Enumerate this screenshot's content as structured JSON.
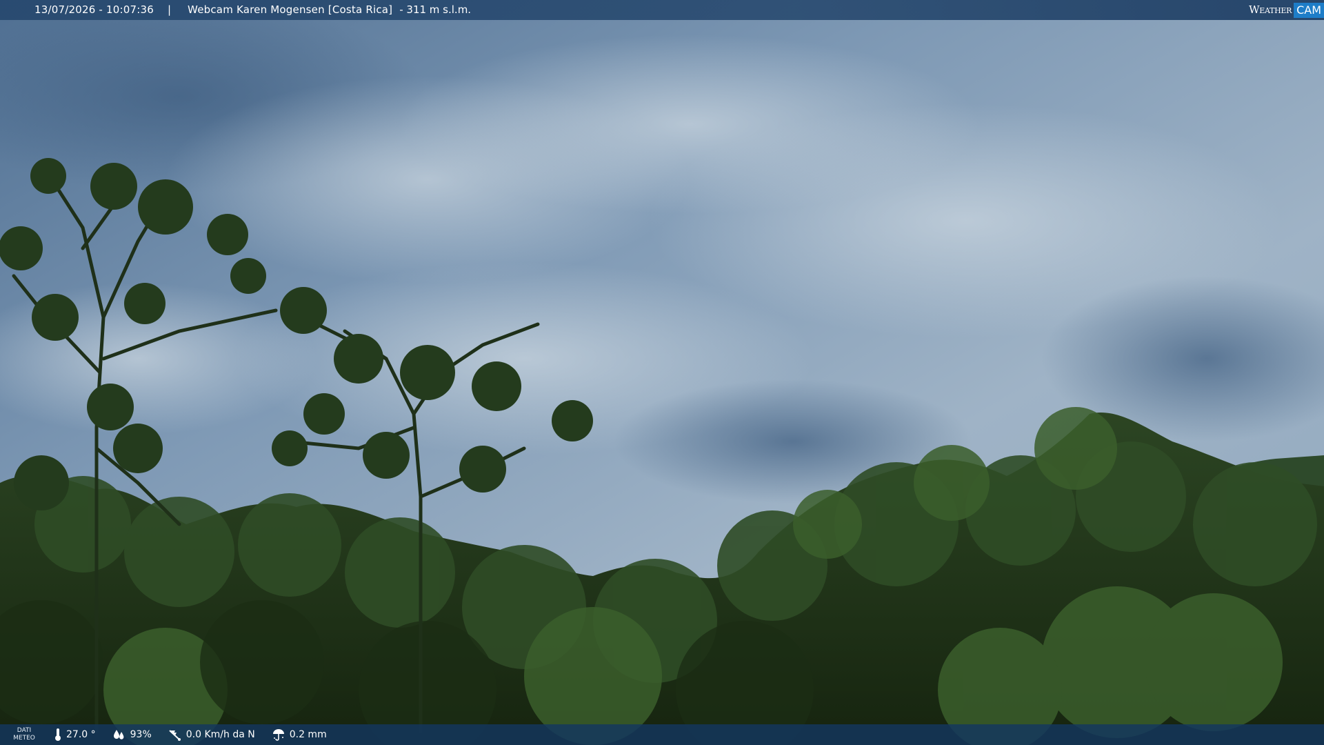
{
  "overlay_top": {
    "datetime": "13/07/2026 - 10:07:36",
    "separator": "|",
    "camera_name": "Webcam Karen Mogensen [Costa Rica]",
    "altitude": "- 311 m s.l.m."
  },
  "logo": {
    "word": "Weather",
    "cam": "CAM"
  },
  "overlay_bottom": {
    "label_line1": "DATI",
    "label_line2": "METEO",
    "temperature": "27.0 °",
    "humidity": "93%",
    "wind": "0.0 Km/h da N",
    "rain": "0.2 mm"
  },
  "icons": [
    "thermometer-icon",
    "humidity-drop-icon",
    "wind-icon",
    "rain-umbrella-icon"
  ],
  "colors": {
    "bar": "#1e4a7a",
    "logo_accent": "#1e7dc8",
    "foliage": "#243d1c"
  }
}
